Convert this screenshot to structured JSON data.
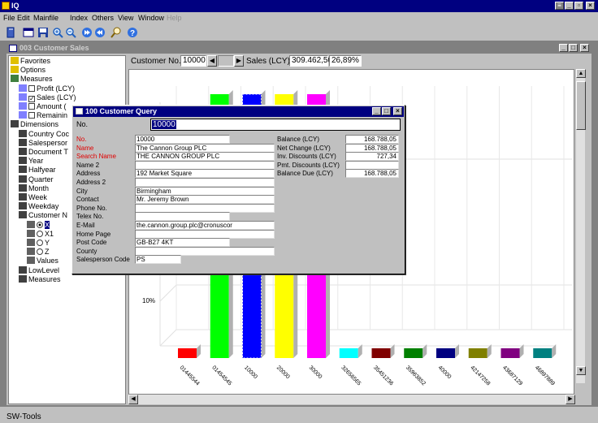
{
  "app": {
    "title": "IQ",
    "menu": [
      "File",
      "Edit",
      "Mainfile",
      "Index",
      "Others",
      "View",
      "Window",
      "Help"
    ]
  },
  "child_window": {
    "title": "003  Customer Sales",
    "header": {
      "customer_no_label": "Customer No.",
      "customer_no_value": "10000",
      "sales_label": "Sales (LCY)",
      "sales_value": "309.462,50",
      "percent": "26,89%"
    }
  },
  "tree": [
    {
      "label": "Favorites",
      "indent": 0,
      "icon": "folder-star-icon",
      "kind": "plain"
    },
    {
      "label": "Options",
      "indent": 0,
      "icon": "folder-icon",
      "kind": "plain"
    },
    {
      "label": "Measures",
      "indent": 0,
      "icon": "measures-icon",
      "kind": "plain"
    },
    {
      "label": "Profit (LCY)",
      "indent": 1,
      "icon": "measure-icon",
      "kind": "check",
      "checked": false
    },
    {
      "label": "Sales (LCY)",
      "indent": 1,
      "icon": "measure-icon",
      "kind": "check",
      "checked": true
    },
    {
      "label": "Amount (",
      "indent": 1,
      "icon": "measure-icon",
      "kind": "check",
      "checked": false
    },
    {
      "label": "Remainin",
      "indent": 1,
      "icon": "measure-icon",
      "kind": "check",
      "checked": false
    },
    {
      "label": "Dimensions",
      "indent": 0,
      "icon": "dimensions-icon",
      "kind": "plain"
    },
    {
      "label": "Country Coc",
      "indent": 1,
      "icon": "dimension-icon",
      "kind": "plain"
    },
    {
      "label": "Salespersor",
      "indent": 1,
      "icon": "dimension-icon",
      "kind": "plain"
    },
    {
      "label": "Document T",
      "indent": 1,
      "icon": "dimension-icon",
      "kind": "plain"
    },
    {
      "label": "Year",
      "indent": 1,
      "icon": "dimension-icon",
      "kind": "plain"
    },
    {
      "label": "Halfyear",
      "indent": 1,
      "icon": "dimension-icon",
      "kind": "plain"
    },
    {
      "label": "Quarter",
      "indent": 1,
      "icon": "dimension-icon",
      "kind": "plain"
    },
    {
      "label": "Month",
      "indent": 1,
      "icon": "dimension-icon",
      "kind": "plain"
    },
    {
      "label": "Week",
      "indent": 1,
      "icon": "dimension-icon",
      "kind": "plain"
    },
    {
      "label": "Weekday",
      "indent": 1,
      "icon": "dimension-icon",
      "kind": "plain"
    },
    {
      "label": "Customer N",
      "indent": 1,
      "icon": "dimension-icon",
      "kind": "plain"
    },
    {
      "label": "X",
      "indent": 2,
      "icon": "axis-icon",
      "kind": "radio",
      "selected": true
    },
    {
      "label": "X1",
      "indent": 2,
      "icon": "axis-icon",
      "kind": "radio",
      "selected": false
    },
    {
      "label": "Y",
      "indent": 2,
      "icon": "axis-icon",
      "kind": "radio",
      "selected": false
    },
    {
      "label": "Z",
      "indent": 2,
      "icon": "axis-icon",
      "kind": "radio",
      "selected": false
    },
    {
      "label": "Values",
      "indent": 2,
      "icon": "values-icon",
      "kind": "plain"
    },
    {
      "label": "LowLevel",
      "indent": 1,
      "icon": "dimension-icon",
      "kind": "plain"
    },
    {
      "label": "Measures",
      "indent": 1,
      "icon": "dimension-icon",
      "kind": "plain"
    }
  ],
  "chart_data": {
    "type": "bar",
    "ytick_labels": [
      "10%"
    ],
    "categories": [
      "01445544",
      "01454545",
      "10000",
      "20000",
      "30000",
      "32656565",
      "35451236",
      "35963852",
      "40000",
      "42147258",
      "43687129",
      "46897889"
    ],
    "values": [
      0.5,
      13.5,
      13.5,
      13.5,
      13.5,
      0.5,
      0.5,
      0.5,
      0.5,
      0.5,
      0.5,
      0.5
    ],
    "colors": [
      "#ff0000",
      "#00ff00",
      "#0000ff",
      "#ffff00",
      "#ff00ff",
      "#00ffff",
      "#800000",
      "#008000",
      "#000080",
      "#808000",
      "#800080",
      "#008080"
    ]
  },
  "dialog": {
    "title": "100  Customer Query",
    "no_label": "No.",
    "no_value": "10000",
    "left_fields": [
      {
        "label": "No.",
        "value": "10000",
        "required": true
      },
      {
        "label": "Name",
        "value": "The Cannon Group PLC",
        "required": true
      },
      {
        "label": "Search Name",
        "value": "THE CANNON GROUP PLC",
        "required": true
      },
      {
        "label": "Name 2",
        "value": "",
        "required": false
      },
      {
        "label": "Address",
        "value": "192 Market Square",
        "required": false
      },
      {
        "label": "Address 2",
        "value": "",
        "required": false
      },
      {
        "label": "City",
        "value": "Birmingham",
        "required": false
      },
      {
        "label": "Contact",
        "value": "Mr. Jeremy Brown",
        "required": false
      },
      {
        "label": "Phone No.",
        "value": "",
        "required": false
      },
      {
        "label": "Telex No.",
        "value": "",
        "required": false
      },
      {
        "label": "E-Mail",
        "value": "the.cannon.group.plc@cronuscor",
        "required": false
      },
      {
        "label": "Home Page",
        "value": "",
        "required": false
      },
      {
        "label": "Post Code",
        "value": "GB-B27 4KT",
        "required": false
      },
      {
        "label": "County",
        "value": "",
        "required": false
      },
      {
        "label": "Salesperson Code",
        "value": "PS",
        "required": false
      }
    ],
    "right_fields": [
      {
        "label": "Balance (LCY)",
        "value": "168.788,05"
      },
      {
        "label": "Net Change (LCY)",
        "value": "168.788,05"
      },
      {
        "label": "Inv. Discounts (LCY)",
        "value": "727,34"
      },
      {
        "label": "Pmt. Discounts (LCY)",
        "value": ""
      },
      {
        "label": "Balance Due (LCY)",
        "value": "168.788,05"
      }
    ]
  },
  "status": {
    "text": "SW-Tools"
  }
}
